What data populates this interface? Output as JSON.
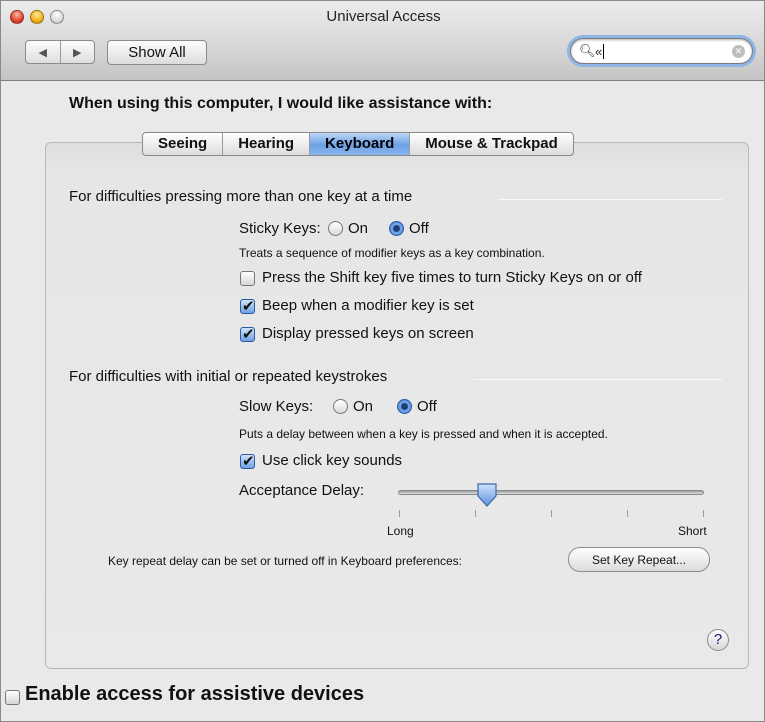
{
  "window": {
    "title": "Universal Access"
  },
  "toolbar": {
    "back_icon": "arrow-left-icon",
    "forward_icon": "arrow-right-icon",
    "show_all_label": "Show All",
    "search_value": "«"
  },
  "main": {
    "heading": "When using this computer, I would like assistance with:",
    "tabs": [
      {
        "label": "Seeing",
        "selected": false
      },
      {
        "label": "Hearing",
        "selected": false
      },
      {
        "label": "Keyboard",
        "selected": true
      },
      {
        "label": "Mouse & Trackpad",
        "selected": false
      }
    ],
    "sticky": {
      "section_title": "For difficulties pressing more than one key at a time",
      "label": "Sticky Keys:",
      "on_label": "On",
      "off_label": "Off",
      "state": "Off",
      "description": "Treats a sequence of modifier keys as a key combination.",
      "options": [
        {
          "label": "Press the Shift key five times to turn Sticky Keys on or off",
          "checked": false
        },
        {
          "label": "Beep when a modifier key is set",
          "checked": true
        },
        {
          "label": "Display pressed keys on screen",
          "checked": true
        }
      ]
    },
    "slow": {
      "section_title": "For difficulties with initial or repeated keystrokes",
      "label": "Slow Keys:",
      "on_label": "On",
      "off_label": "Off",
      "state": "Off",
      "description": "Puts a delay between when a key is pressed and when it is accepted.",
      "click_sounds_label": "Use click key sounds",
      "click_sounds_checked": true,
      "delay_label": "Acceptance Delay:",
      "delay_min_label": "Long",
      "delay_max_label": "Short",
      "delay_value_fraction": 0.29
    },
    "key_repeat_text": "Key repeat delay can be set or turned off in Keyboard preferences:",
    "key_repeat_button": "Set Key Repeat...",
    "help_label": "?"
  },
  "footer": {
    "assistive_label": "Enable access for assistive devices",
    "assistive_checked": false
  },
  "colors": {
    "accent": "#6da1e4",
    "focus_ring": "#8fb4e6"
  }
}
